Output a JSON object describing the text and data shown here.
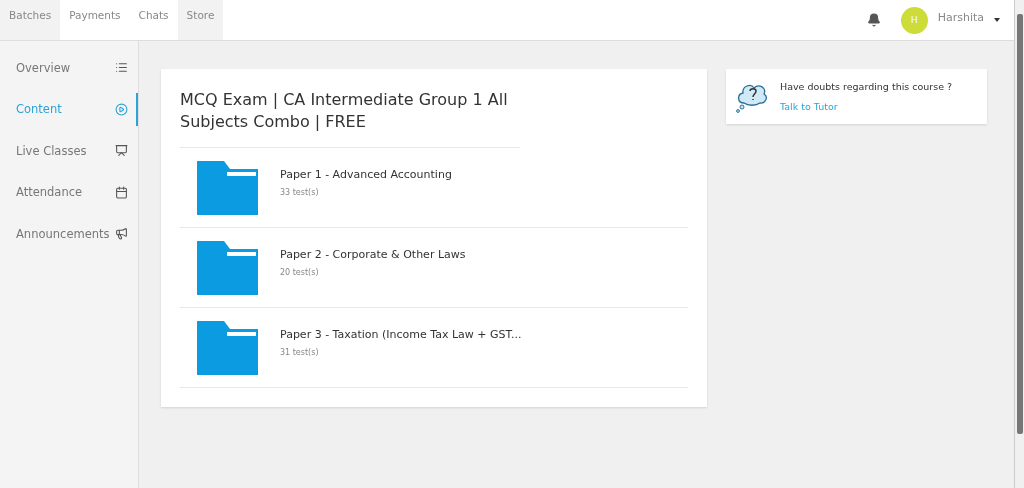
{
  "top_tabs": [
    {
      "label": "Batches",
      "shaded": true
    },
    {
      "label": "Payments",
      "shaded": false
    },
    {
      "label": "Chats",
      "shaded": false
    },
    {
      "label": "Store",
      "shaded": true
    }
  ],
  "user": {
    "avatar_letter": "H",
    "name": "Harshita"
  },
  "sidebar": {
    "items": [
      {
        "label": "Overview",
        "kind": "list",
        "selected": false
      },
      {
        "label": "Content",
        "kind": "play",
        "selected": true
      },
      {
        "label": "Live Classes",
        "kind": "board",
        "selected": false
      },
      {
        "label": "Attendance",
        "kind": "calendar",
        "selected": false
      },
      {
        "label": "Announcements",
        "kind": "megaphone",
        "selected": false
      }
    ]
  },
  "course": {
    "title": "MCQ Exam | CA Intermediate Group 1 All Subjects Combo | FREE",
    "folders": [
      {
        "name": "Paper 1 - Advanced Accounting",
        "count": "33 test(s)"
      },
      {
        "name": "Paper 2 - Corporate & Other Laws",
        "count": "20 test(s)"
      },
      {
        "name": "Paper 3 - Taxation (Income Tax Law + GST...",
        "count": "31 test(s)"
      }
    ]
  },
  "help": {
    "question": "Have doubts regarding this course ?",
    "link": "Talk to Tutor"
  }
}
